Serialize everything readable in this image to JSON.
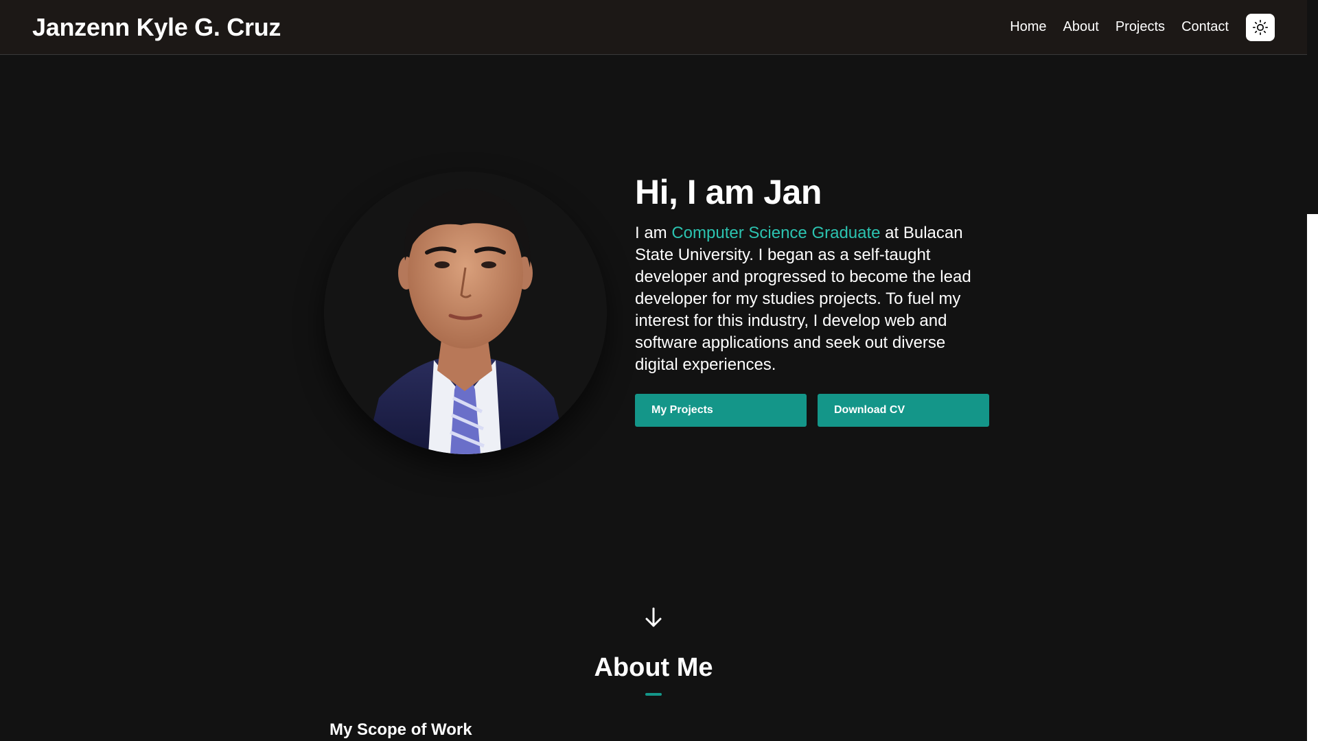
{
  "navbar": {
    "brand": "Janzenn Kyle G. Cruz",
    "links": [
      "Home",
      "About",
      "Projects",
      "Contact"
    ],
    "theme_icon": "sun-icon"
  },
  "hero": {
    "greeting": "Hi, I am Jan",
    "desc_prefix": "I am ",
    "desc_highlight": "Computer Science Graduate",
    "desc_rest": " at Bulacan State University. I began as a self-taught developer and progressed to become the lead developer for my studies projects. To fuel my interest for this industry, I develop web and software applications and seek out diverse digital experiences.",
    "buttons": {
      "projects": "My Projects",
      "cv": "Download CV"
    }
  },
  "about": {
    "title": "About Me",
    "scope_title": "My Scope of Work"
  },
  "colors": {
    "accent": "#2cc3b0",
    "button": "#149689",
    "background": "#121212",
    "navbar": "#1c1816"
  }
}
